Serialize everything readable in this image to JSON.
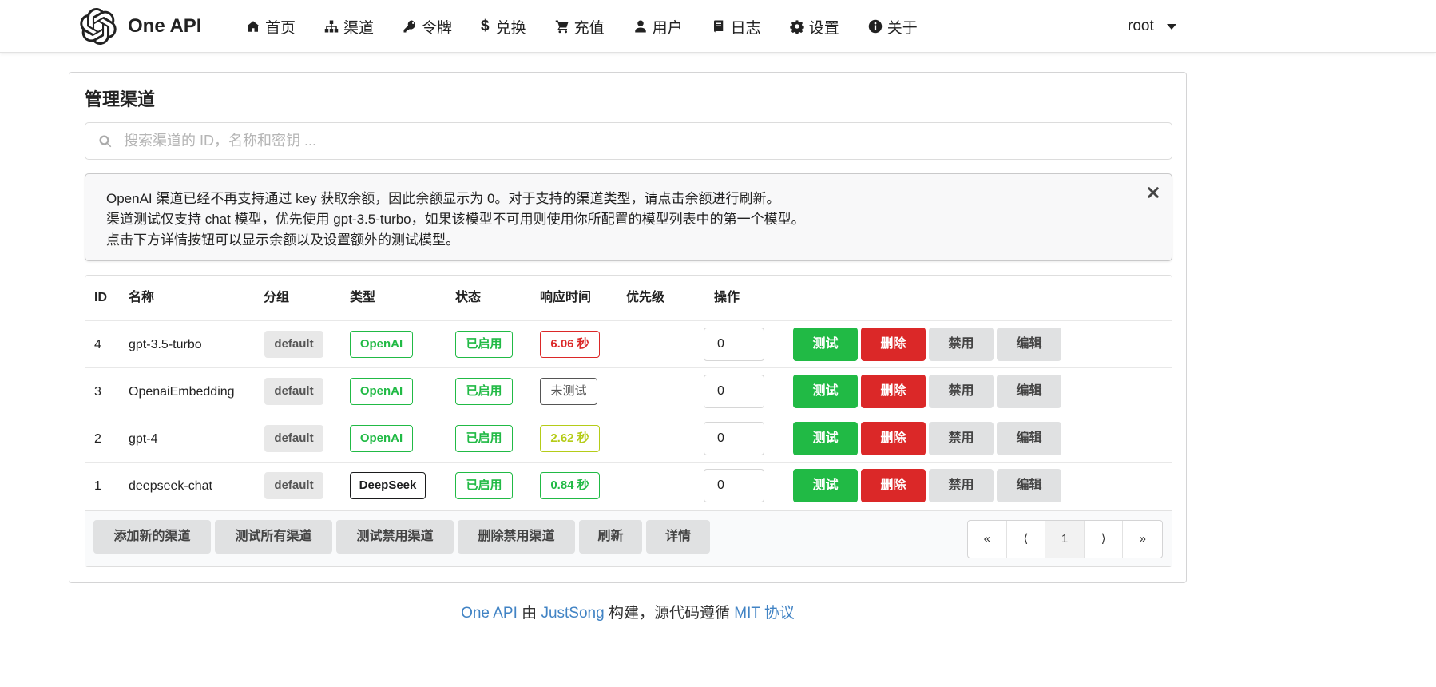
{
  "header": {
    "brand": "One API",
    "nav": [
      {
        "label": "首页",
        "icon": "home-icon"
      },
      {
        "label": "渠道",
        "icon": "sitemap-icon"
      },
      {
        "label": "令牌",
        "icon": "key-icon"
      },
      {
        "label": "兑换",
        "icon": "dollar-icon"
      },
      {
        "label": "充值",
        "icon": "cart-icon"
      },
      {
        "label": "用户",
        "icon": "user-icon"
      },
      {
        "label": "日志",
        "icon": "book-icon"
      },
      {
        "label": "设置",
        "icon": "gear-icon"
      },
      {
        "label": "关于",
        "icon": "info-icon"
      }
    ],
    "user": "root"
  },
  "page": {
    "title": "管理渠道",
    "search_placeholder": "搜索渠道的 ID，名称和密钥 ...",
    "message_lines": [
      "OpenAI 渠道已经不再支持通过 key 获取余额，因此余额显示为 0。对于支持的渠道类型，请点击余额进行刷新。",
      "渠道测试仅支持 chat 模型，优先使用 gpt-3.5-turbo，如果该模型不可用则使用你所配置的模型列表中的第一个模型。",
      "点击下方详情按钮可以显示余额以及设置额外的测试模型。"
    ]
  },
  "table": {
    "headers": {
      "id": "ID",
      "name": "名称",
      "group": "分组",
      "type": "类型",
      "status": "状态",
      "response": "响应时间",
      "priority": "优先级",
      "actions": "操作"
    },
    "rows": [
      {
        "id": "4",
        "name": "gpt-3.5-turbo",
        "group": "default",
        "type": "OpenAI",
        "status": "已启用",
        "response": "6.06 秒",
        "priority": "0"
      },
      {
        "id": "3",
        "name": "OpenaiEmbedding",
        "group": "default",
        "type": "OpenAI",
        "status": "已启用",
        "response": "未测试",
        "priority": "0"
      },
      {
        "id": "2",
        "name": "gpt-4",
        "group": "default",
        "type": "OpenAI",
        "status": "已启用",
        "response": "2.62 秒",
        "priority": "0"
      },
      {
        "id": "1",
        "name": "deepseek-chat",
        "group": "default",
        "type": "DeepSeek",
        "status": "已启用",
        "response": "0.84 秒",
        "priority": "0"
      }
    ],
    "action_labels": {
      "test": "测试",
      "delete": "删除",
      "disable": "禁用",
      "edit": "编辑"
    },
    "footer_buttons": [
      "添加新的渠道",
      "测试所有渠道",
      "测试禁用渠道",
      "删除禁用渠道",
      "刷新",
      "详情"
    ],
    "pagination": {
      "first": "«",
      "prev": "⟨",
      "current": "1",
      "next": "⟩",
      "last": "»"
    }
  },
  "colors": {
    "green": "#21ba45",
    "red": "#db2828",
    "olive": "#b5cc18",
    "link": "#4183c4"
  },
  "footer": {
    "project": "One API",
    "by": "由",
    "author": "JustSong",
    "built": "构建，源代码遵循",
    "license": "MIT 协议"
  }
}
